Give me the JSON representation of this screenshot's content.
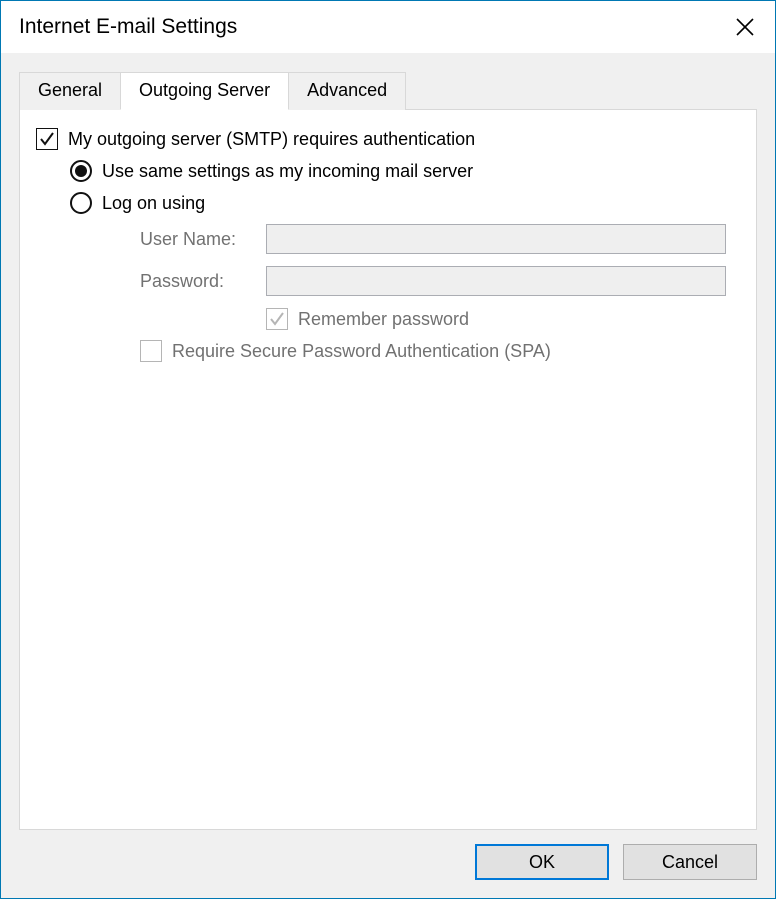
{
  "title": "Internet E-mail Settings",
  "tabs": {
    "general": "General",
    "outgoing": "Outgoing Server",
    "advanced": "Advanced"
  },
  "form": {
    "requires_auth_label": "My outgoing server (SMTP) requires authentication",
    "requires_auth_checked": true,
    "option_same_label": "Use same settings as my incoming mail server",
    "option_log_on_label": "Log on using",
    "selected_option": "same",
    "username_label": "User Name:",
    "username_value": "",
    "password_label": "Password:",
    "password_value": "",
    "remember_label": "Remember password",
    "remember_checked": true,
    "spa_label": "Require Secure Password Authentication (SPA)",
    "spa_checked": false
  },
  "buttons": {
    "ok": "OK",
    "cancel": "Cancel"
  }
}
